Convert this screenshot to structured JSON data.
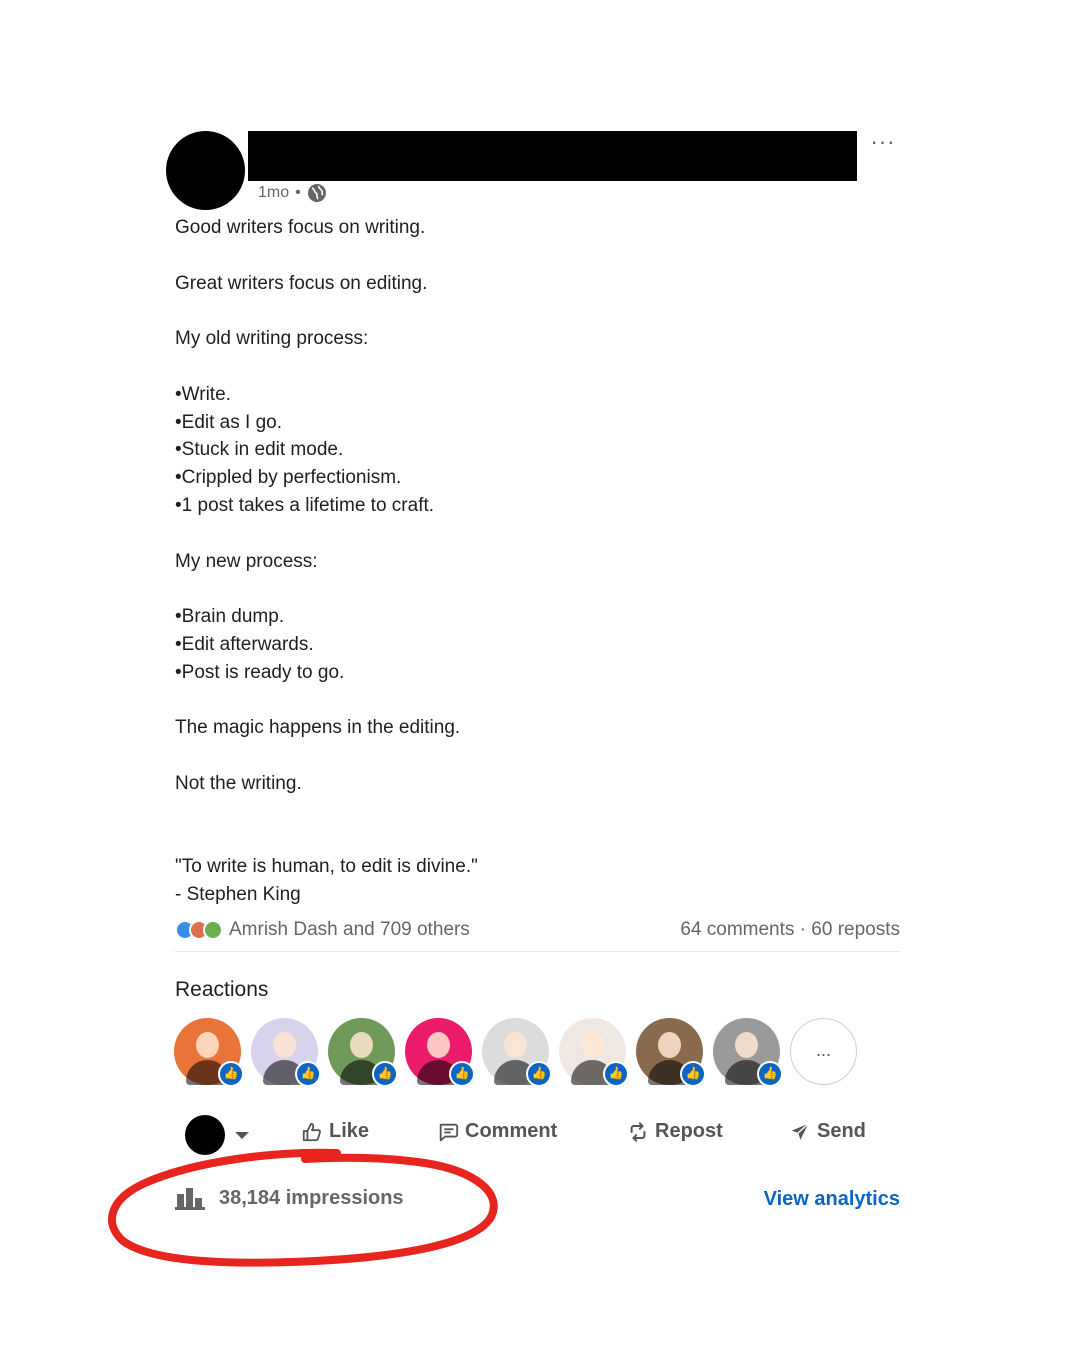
{
  "post": {
    "time": "1mo",
    "meta_separator": "•",
    "more_label": "···",
    "lines": [
      "Good writers focus on writing.",
      "",
      "Great writers focus on editing.",
      "",
      "My old writing process:",
      "",
      "•Write.",
      "•Edit as I go.",
      "•Stuck in edit mode.",
      "•Crippled by perfectionism.",
      "•1 post takes a lifetime to craft.",
      "",
      "My new process:",
      "",
      "•Brain dump.",
      "•Edit afterwards.",
      "•Post is ready to go.",
      "",
      "The magic happens in the editing.",
      "",
      "Not the writing.",
      "",
      "",
      "\"To write is human, to edit is divine.\"",
      "- Stephen King"
    ]
  },
  "social": {
    "reactors_text": "Amrish Dash and 709 others",
    "counts_text": "64 comments · 60 reposts"
  },
  "reactions": {
    "title": "Reactions",
    "more_label": "...",
    "avatar_colors": [
      "#e9743a",
      "#d9d2ec",
      "#6f9a5a",
      "#ec1a6a",
      "#dcdcdc",
      "#efe7e2",
      "#8a6a4c",
      "#9a9a9a"
    ]
  },
  "actions": {
    "like": "Like",
    "comment": "Comment",
    "repost": "Repost",
    "send": "Send"
  },
  "footer": {
    "impressions": "38,184 impressions",
    "view_analytics": "View analytics"
  },
  "colors": {
    "link": "#0a66c2",
    "annotation": "#e8241f",
    "like_blue": "#378fe9",
    "love_red": "#df704d",
    "support_green": "#6dae4f"
  }
}
